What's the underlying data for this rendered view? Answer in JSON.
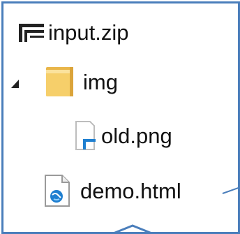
{
  "tree": {
    "items": [
      {
        "label": "input.zip",
        "icon": "zip-archive-icon",
        "depth": 0,
        "expandable": false
      },
      {
        "label": "img",
        "icon": "folder-icon",
        "depth": 1,
        "expandable": true,
        "expanded": true
      },
      {
        "label": "old.png",
        "icon": "image-file-icon",
        "depth": 2,
        "expandable": false
      },
      {
        "label": "demo.html",
        "icon": "html-file-icon",
        "depth": 1,
        "expandable": false
      }
    ]
  },
  "colors": {
    "border": "#4a7ebb",
    "folder": "#f6cf6a",
    "accent_blue": "#1f7fd0",
    "text": "#111111"
  }
}
